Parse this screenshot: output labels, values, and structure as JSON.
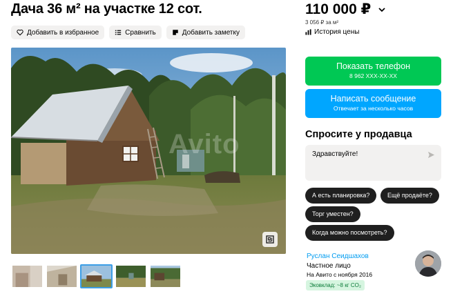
{
  "listing": {
    "title": "Дача 36 м² на участке 12 сот.",
    "actions": {
      "favorite": "Добавить в избранное",
      "compare": "Сравнить",
      "note": "Добавить заметку"
    },
    "gallery": {
      "watermark": "Avito",
      "thumbnail_count": 5,
      "active_thumbnail": 3
    }
  },
  "sidebar": {
    "price": "110 000 ₽",
    "price_per_sqm": "3 056 ₽ за м²",
    "price_history": "История цены",
    "show_phone": {
      "label": "Показать телефон",
      "sub": "8 962 XXX-XX-XX"
    },
    "write_message": {
      "label": "Написать сообщение",
      "sub": "Отвечает за несколько часов"
    },
    "ask_title": "Спросите у продавца",
    "message_value": "Здравствуйте!",
    "quick_questions": [
      "А есть планировка?",
      "Ещё продаёте?",
      "Торг уместен?",
      "Когда можно посмотреть?"
    ],
    "seller": {
      "name": "Руслан Сеидшахов",
      "type": "Частное лицо",
      "since": "На Авито с ноября 2016",
      "eco": "Эковклад: ~8 кг CO₂"
    }
  },
  "colors": {
    "green": "#00c854",
    "blue": "#00a6ff",
    "link": "#009cf0",
    "chip": "#1f1f1f"
  }
}
